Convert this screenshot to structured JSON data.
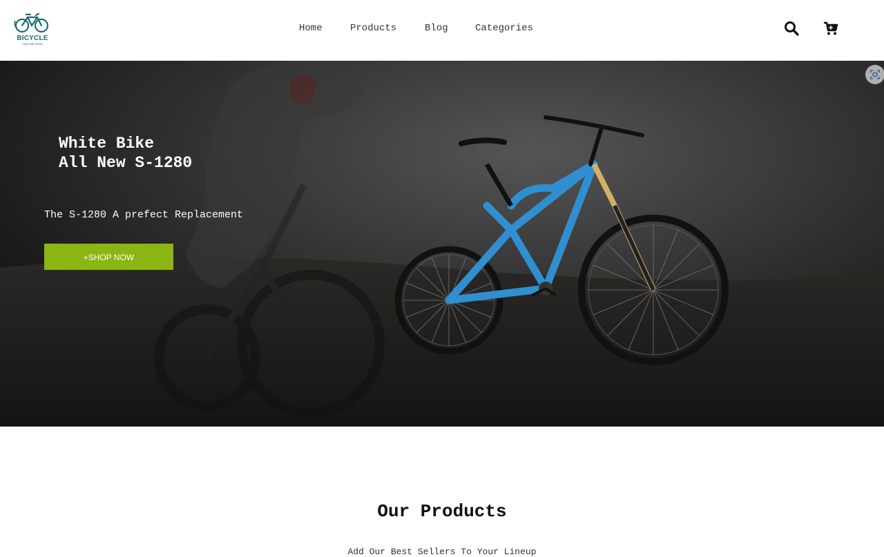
{
  "brand": {
    "name": "BICYCLE",
    "tagline": "TAGLINE HERE",
    "color": "#1d6b73"
  },
  "nav": {
    "items": [
      "Home",
      "Products",
      "Blog",
      "Categories"
    ]
  },
  "header_icons": {
    "search": "search-icon",
    "cart": "cart-icon"
  },
  "hero": {
    "title_line1": "White Bike",
    "title_line2": "All New S-1280",
    "subtitle": "The S-1280 A prefect Replacement",
    "cta_label": "+SHOP NOW",
    "cta_color": "#8ab512",
    "bike_color": "#2f8fd0"
  },
  "products": {
    "title": "Our Products",
    "subtitle": "Add Our Best Sellers To Your Lineup"
  }
}
